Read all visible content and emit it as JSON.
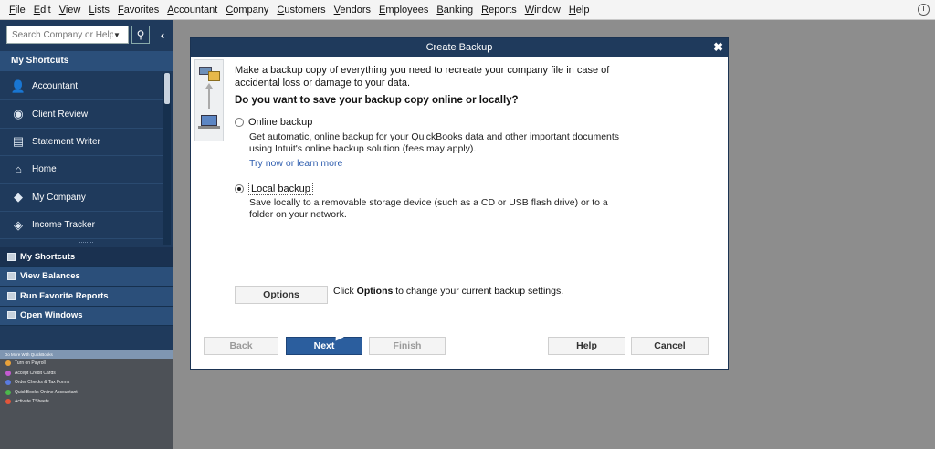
{
  "menubar": {
    "items": [
      "File",
      "Edit",
      "View",
      "Lists",
      "Favorites",
      "Accountant",
      "Company",
      "Customers",
      "Vendors",
      "Employees",
      "Banking",
      "Reports",
      "Window",
      "Help"
    ]
  },
  "sidebar": {
    "search_placeholder": "Search Company or Help",
    "search_icon": "magnifier-icon",
    "collapse_glyph": "‹",
    "shortcuts_header": "My Shortcuts",
    "shortcuts": [
      {
        "label": "Accountant",
        "icon": "person-icon"
      },
      {
        "label": "Client Review",
        "icon": "client-review-icon"
      },
      {
        "label": "Statement Writer",
        "icon": "statement-writer-icon"
      },
      {
        "label": "Home",
        "icon": "home-icon"
      },
      {
        "label": "My Company",
        "icon": "my-company-icon"
      },
      {
        "label": "Income Tracker",
        "icon": "income-tracker-icon"
      }
    ],
    "panels": [
      "My Shortcuts",
      "View Balances",
      "Run Favorite Reports",
      "Open Windows"
    ],
    "domore": {
      "header": "Do More With QuickBooks",
      "items": [
        {
          "label": "Turn on Payroll",
          "color": "#e8a23a"
        },
        {
          "label": "Accept Credit Cards",
          "color": "#c35bd0"
        },
        {
          "label": "Order Checks & Tax Forms",
          "color": "#5a7be0"
        },
        {
          "label": "QuickBooks Online Accountant",
          "color": "#4cb84c"
        },
        {
          "label": "Activate TSheets",
          "color": "#e2553a"
        }
      ]
    }
  },
  "dialog": {
    "title": "Create Backup",
    "close_glyph": "✖",
    "intro": "Make a backup copy of everything you need to recreate your company file in case of accidental loss or damage to your data.",
    "question": "Do you want to save your backup copy online or locally?",
    "online": {
      "label": "Online backup",
      "checked": false,
      "desc": "Get automatic, online backup for your QuickBooks data and other important documents using Intuit's online backup solution (fees may apply).",
      "link": "Try now or learn more"
    },
    "local": {
      "label": "Local backup",
      "checked": true,
      "desc": "Save locally to a removable storage device (such as a CD or USB flash drive) or to a folder on your network."
    },
    "options_button": "Options",
    "options_hint_pre": "Click ",
    "options_hint_bold": "Options",
    "options_hint_post": " to change your current backup settings.",
    "buttons": {
      "back": "Back",
      "next": "Next",
      "finish": "Finish",
      "help": "Help",
      "cancel": "Cancel"
    }
  }
}
